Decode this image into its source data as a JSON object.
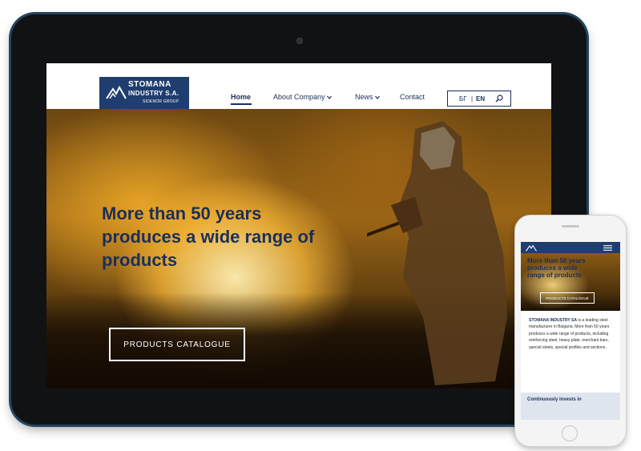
{
  "tablet": {
    "logo": {
      "line1": "STOMANA",
      "line2": "INDUSTRY S.A.",
      "line3": "SIDENOR GROUP"
    },
    "nav": {
      "home": "Home",
      "about": "About Company",
      "news": "News",
      "contact": "Contact"
    },
    "lang": {
      "bg": "БГ",
      "separator": "|",
      "en": "EN"
    },
    "hero": {
      "headline": "More than 50 years produces a wide range of products",
      "cta": "PRODUCTS CATALOGUE"
    },
    "icons": {
      "search": "search-icon",
      "chevron": "chevron-down-icon"
    }
  },
  "phone": {
    "hero": {
      "headline": "More than 50 years produces a wide range of products",
      "cta": "PRODUCTS CATALOGUE"
    },
    "body": {
      "company": "STOMANA INDUSTRY SA",
      "text": "is a leading steel manufacturer in Bulgaria. More than 50 years produces a wide range of products, including reinforcing steel, heavy plate, merchant bars, special steels, special profiles and sections."
    },
    "band_title": "Continuously invests in",
    "icons": {
      "menu": "hamburger-menu-icon"
    }
  },
  "colors": {
    "brand_navy": "#1f3d6f",
    "text_navy": "#1b2f5a",
    "device_frame": "#101214"
  }
}
